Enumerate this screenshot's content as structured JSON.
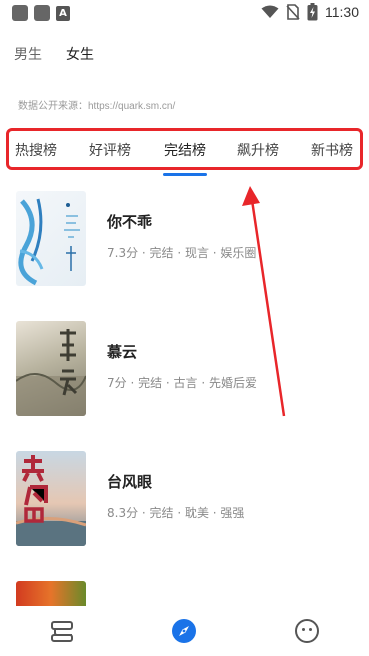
{
  "status_bar": {
    "time": "11:30",
    "notification_letter": "A"
  },
  "gender_tabs": [
    {
      "label": "男生",
      "active": false
    },
    {
      "label": "女生",
      "active": true
    }
  ],
  "source_note": "数据公开来源：https://quark.sm.cn/",
  "rank_tabs": [
    {
      "label": "热搜榜",
      "active": false
    },
    {
      "label": "好评榜",
      "active": false
    },
    {
      "label": "完结榜",
      "active": true
    },
    {
      "label": "飙升榜",
      "active": false
    },
    {
      "label": "新书榜",
      "active": false
    }
  ],
  "books": [
    {
      "title": "你不乖",
      "meta": "7.3分 · 完结 · 现言 · 娱乐圈",
      "cover_text": "你不乖"
    },
    {
      "title": "慕云",
      "meta": "7分 · 完结 · 古言 · 先婚后爱",
      "cover_text": "慕云"
    },
    {
      "title": "台风眼",
      "meta": "8.3分 · 完结 · 耽美 · 强强",
      "cover_text": "台风眼"
    },
    {
      "title": "",
      "meta": "",
      "cover_text": ""
    }
  ],
  "bottom_nav": [
    {
      "icon": "bookshelf-icon",
      "active": false
    },
    {
      "icon": "compass-icon",
      "active": true
    },
    {
      "icon": "profile-face-icon",
      "active": false
    }
  ],
  "colors": {
    "accent": "#1a73e8",
    "annotation_red": "#e8262a",
    "meta_gray": "#8a8a8a"
  }
}
